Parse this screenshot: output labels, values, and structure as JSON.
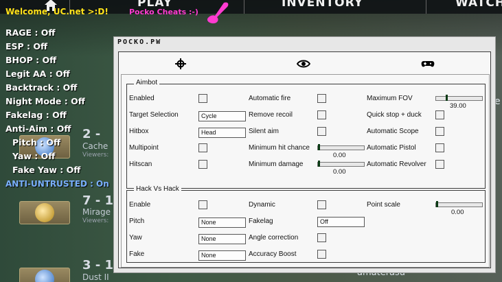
{
  "topnav": {
    "play": "PLAY",
    "inventory": "INVENTORY",
    "watch": "WATCH"
  },
  "overlay": {
    "welcome": "Welcome, UC.net >:D!",
    "brand": "Pocko Cheats :-)",
    "menu": [
      "RAGE : Off",
      "ESP : Off",
      "BHOP : Off",
      "Legit AA : Off",
      "Backtrack : Off",
      "Night Mode : Off",
      "Fakelag : Off",
      "Anti-Aim : Off"
    ],
    "submenu": [
      "Pitch : Off",
      "Yaw : Off",
      "Fake Yaw : Off"
    ],
    "anti_untrusted": "ANTI-UNTRUSTED : On",
    "colors": {
      "welcome": "#ffe21a",
      "brand": "#ff3bd0",
      "anti_untrusted": "#7ab0ff"
    }
  },
  "background": {
    "matches": [
      {
        "num": "2 -",
        "name": "Cache",
        "sub": "Viewers:"
      },
      {
        "num": "7 - 1",
        "name": "Mirage",
        "sub": "Viewers:"
      },
      {
        "num": "3 - 1",
        "name": "Dust II",
        "sub": ""
      }
    ],
    "friend": "amaterasu",
    "right_edge_letter": "e"
  },
  "window": {
    "title": "POCKO.PW",
    "tabs": [
      "crosshair-icon",
      "eye-icon",
      "gamepad-icon"
    ],
    "aimbot": {
      "title": "Aimbot",
      "col1": {
        "enabled": "Enabled",
        "target_selection": "Target Selection",
        "target_selection_value": "Cycle",
        "hitbox": "Hitbox",
        "hitbox_value": "Head",
        "multipoint": "Multipoint",
        "hitscan": "Hitscan"
      },
      "col2": {
        "automatic_fire": "Automatic fire",
        "remove_recoil": "Remove recoil",
        "silent_aim": "Silent aim",
        "min_hit_chance": "Minimum hit chance",
        "min_hit_chance_value": "0.00",
        "min_damage": "Minimum damage",
        "min_damage_value": "0.00"
      },
      "col3": {
        "max_fov": "Maximum FOV",
        "max_fov_value": "39.00",
        "quick_stop": "Quick stop + duck",
        "auto_scope": "Automatic Scope",
        "auto_pistol": "Automatic Pistol",
        "auto_revolver": "Automatic Revolver"
      }
    },
    "hvh": {
      "title": "Hack Vs Hack",
      "col1": {
        "enable": "Enable",
        "pitch": "Pitch",
        "pitch_value": "None",
        "yaw": "Yaw",
        "yaw_value": "None",
        "fake": "Fake",
        "fake_value": "None"
      },
      "col2": {
        "dynamic": "Dynamic",
        "fakelag": "Fakelag",
        "fakelag_value": "Off",
        "angle_correction": "Angle correction",
        "accuracy_boost": "Accuracy Boost"
      },
      "col3": {
        "point_scale": "Point scale",
        "point_scale_value": "0.00"
      }
    }
  }
}
